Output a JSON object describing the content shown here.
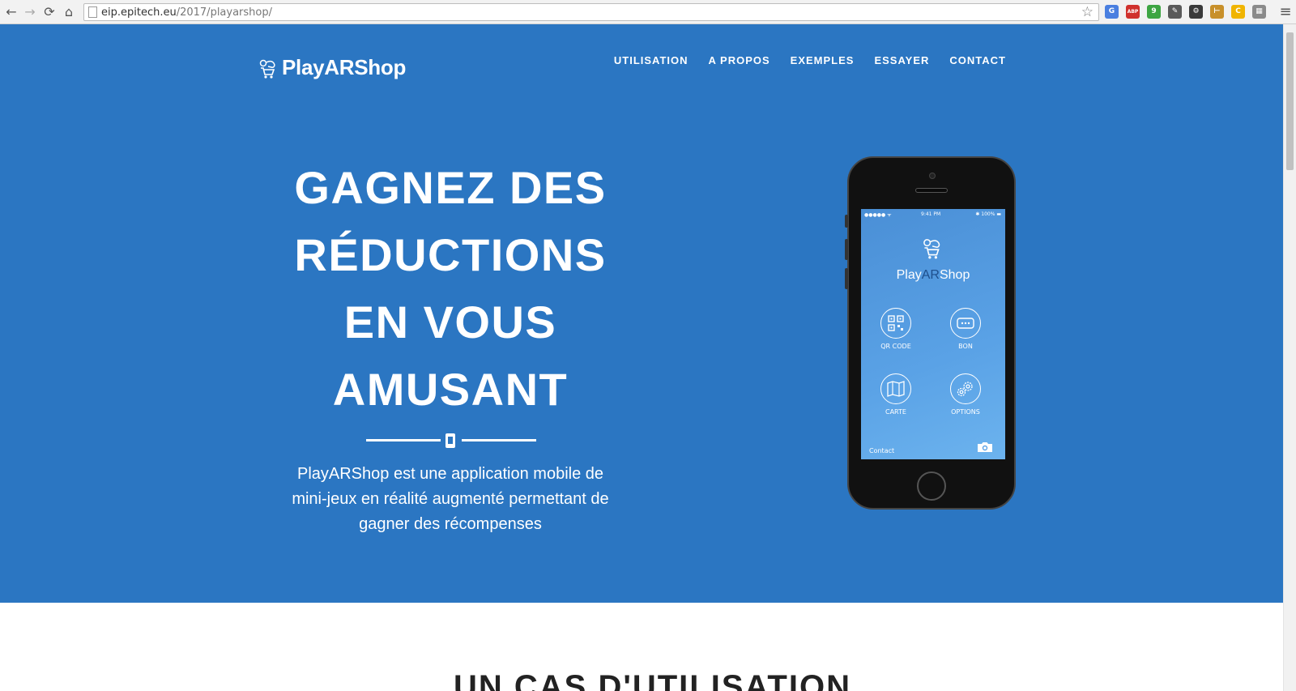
{
  "browser": {
    "url_host": "eip.epitech.eu",
    "url_path": "/2017/playarshop/",
    "back_icon": "←",
    "forward_icon": "→",
    "reload_icon": "⟳",
    "home_icon": "⌂",
    "star_icon": "☆",
    "menu_icon": "≡",
    "extensions": [
      {
        "name": "translate-icon",
        "label": "G",
        "color": "#4a7fe0"
      },
      {
        "name": "adblock-icon",
        "label": "ABP",
        "color": "#d0312d"
      },
      {
        "name": "evernote-icon",
        "label": "9",
        "color": "#3da542"
      },
      {
        "name": "eyedropper-icon",
        "label": "✎",
        "color": "#5a5a5a"
      },
      {
        "name": "gear-icon",
        "label": "⚙",
        "color": "#3a3a3a"
      },
      {
        "name": "ruler-icon",
        "label": "⊢",
        "color": "#c8902a"
      },
      {
        "name": "coupon-icon",
        "label": "C",
        "color": "#f0b400"
      },
      {
        "name": "puzzle-icon",
        "label": "▦",
        "color": "#8a8a8a"
      }
    ]
  },
  "site": {
    "brand": "PlayARShop",
    "nav": [
      "UTILISATION",
      "A PROPOS",
      "EXEMPLES",
      "ESSAYER",
      "CONTACT"
    ]
  },
  "hero": {
    "headline_lines": [
      "GAGNEZ DES",
      "RÉDUCTIONS",
      "EN VOUS",
      "AMUSANT"
    ],
    "tagline_lines": [
      "PlayARShop est une application mobile de",
      "mini-jeux en réalité augmenté permettant de",
      "gagner des récompenses"
    ],
    "bg_color": "#2b76c2"
  },
  "phone_screen": {
    "status_signal": "●●●●● ᯤ",
    "status_time": "9:41 PM",
    "status_battery": "✱ 100% ▬",
    "title_play": "Play",
    "title_ar": "AR",
    "title_shop": "Shop",
    "tiles": [
      "QR CODE",
      "BON",
      "CARTE",
      "OPTIONS"
    ],
    "contact": "Contact"
  },
  "next_section": {
    "title": "UN CAS D'UTILISATION"
  }
}
